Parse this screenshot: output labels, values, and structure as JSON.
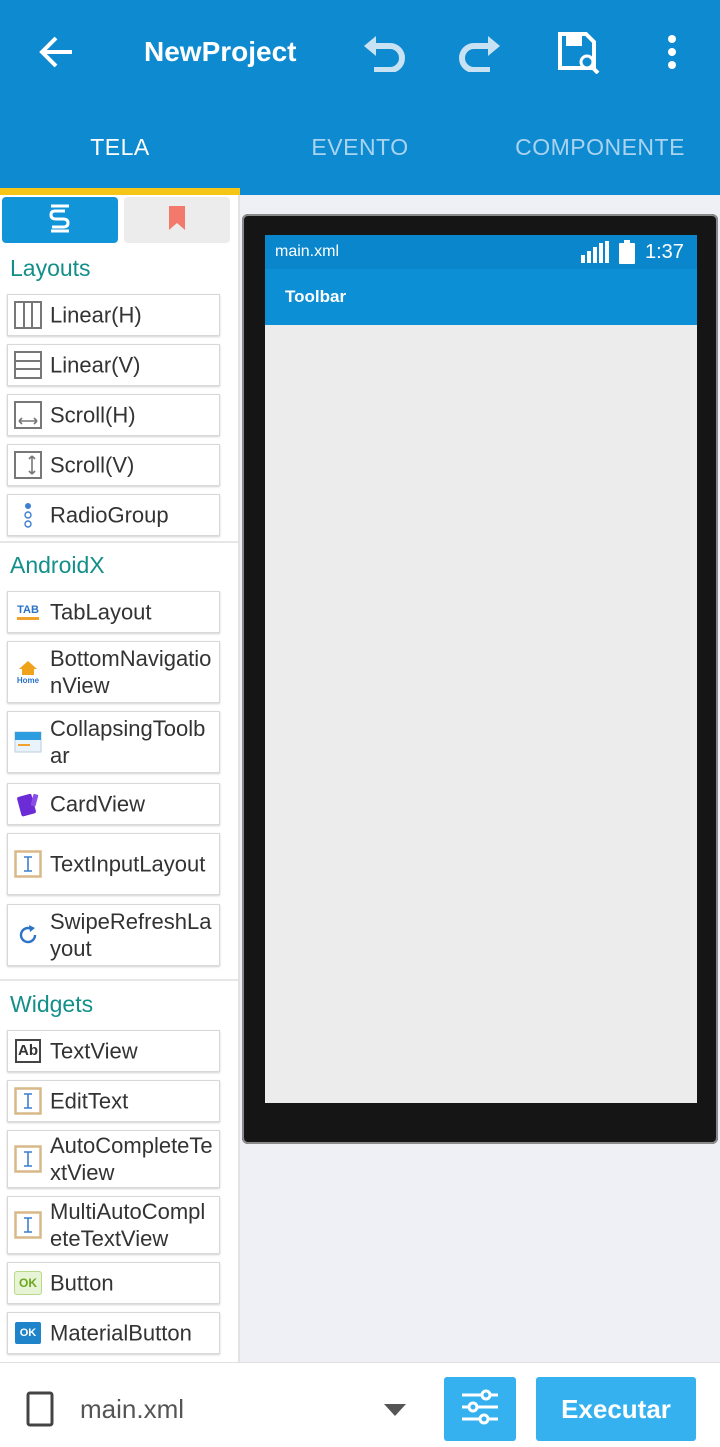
{
  "appbar": {
    "title": "NewProject"
  },
  "tabs": [
    "TELA",
    "EVENTO",
    "COMPONENTE"
  ],
  "palette": {
    "sections": {
      "layouts": "Layouts",
      "androidx": "AndroidX",
      "widgets": "Widgets"
    },
    "layouts": [
      "Linear(H)",
      "Linear(V)",
      "Scroll(H)",
      "Scroll(V)",
      "RadioGroup"
    ],
    "androidx": [
      "TabLayout",
      "BottomNavigationView",
      "CollapsingToolbar",
      "CardView",
      "TextInputLayout",
      "SwipeRefreshLayout"
    ],
    "widgets": [
      "TextView",
      "EditText",
      "AutoCompleteTextView",
      "MultiAutoCompleteTextView",
      "Button",
      "MaterialButton"
    ]
  },
  "icons": {
    "tab_home_text": "Home",
    "tab_text": "TAB",
    "textview_text": "Ab",
    "button_text": "OK",
    "materialbutton_text": "OK"
  },
  "preview": {
    "filename": "main.xml",
    "time": "1:37",
    "toolbar_title": "Toolbar"
  },
  "bottom": {
    "file": "main.xml",
    "run_label": "Executar"
  },
  "colors": {
    "primary": "#0d8ad0",
    "accent": "#35b1f0",
    "indicator": "#f5c518",
    "section": "#138f8a"
  }
}
